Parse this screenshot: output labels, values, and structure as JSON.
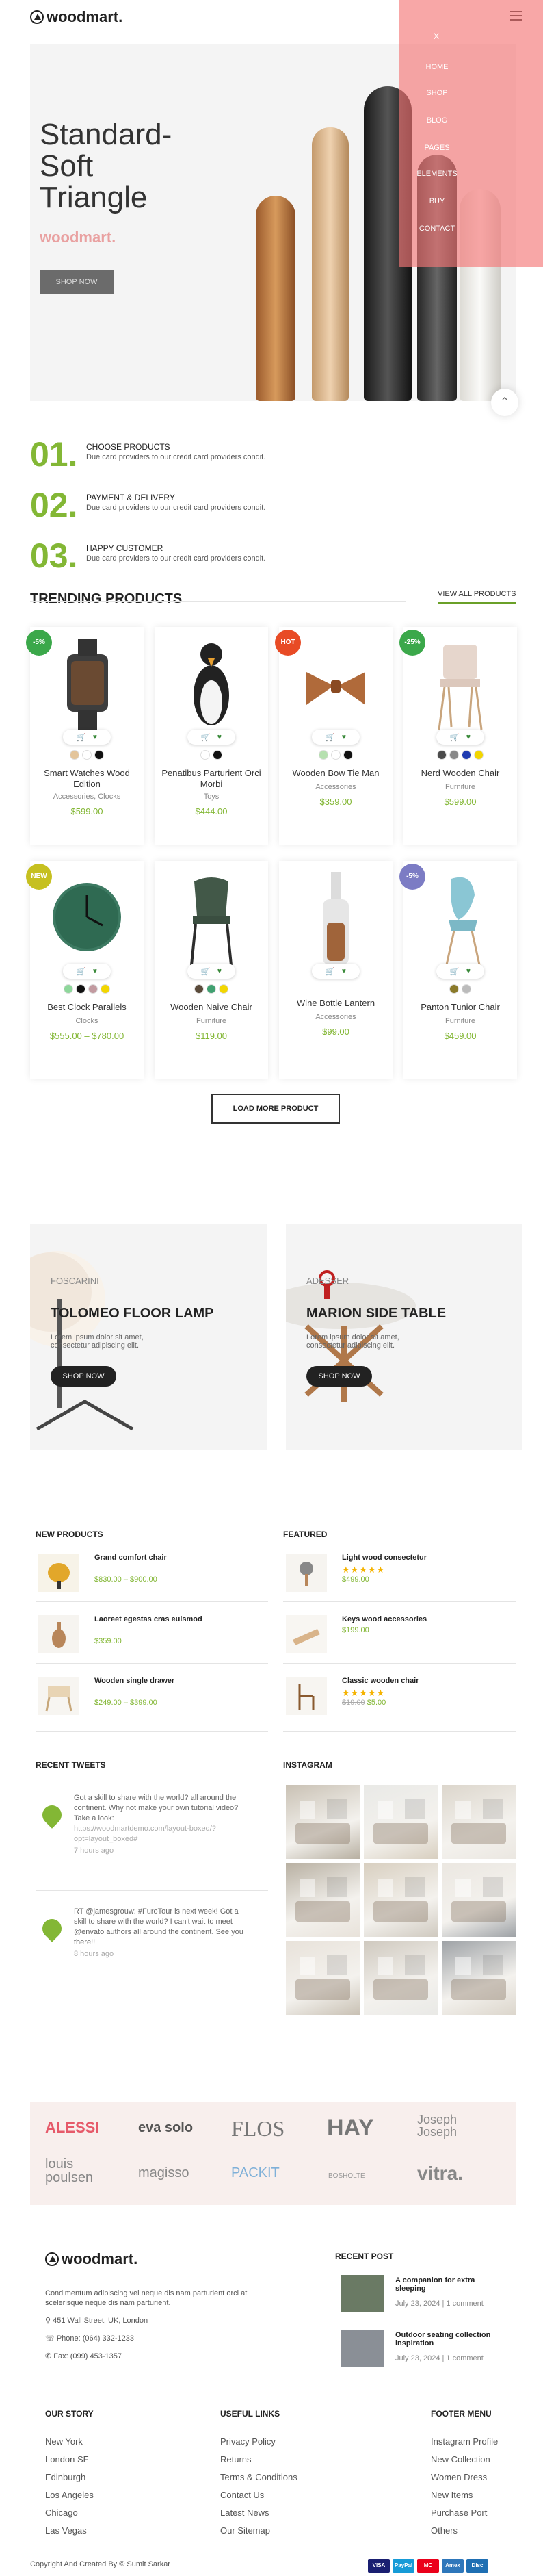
{
  "header": {
    "logo": "woodmart."
  },
  "menu": {
    "close": "X",
    "items": [
      "HOME",
      "SHOP",
      "BLOG",
      "PAGES",
      "ELEMENTS",
      "BUY",
      "CONTACT"
    ]
  },
  "hero": {
    "title": "Standard-Soft Triangle",
    "brand": "woodmart.",
    "button": "SHOP NOW"
  },
  "features": [
    {
      "num": "01.",
      "title": "CHOOSE PRODUCTS",
      "desc": "Due card providers to our credit card providers condit."
    },
    {
      "num": "02.",
      "title": "PAYMENT & DELIVERY",
      "desc": "Due card providers to our credit card providers condit."
    },
    {
      "num": "03.",
      "title": "HAPPY CUSTOMER",
      "desc": "Due card providers to our credit card providers condit."
    }
  ],
  "trending": {
    "title": "TRENDING PRODUCTS",
    "view_all": "VIEW ALL PRODUCTS",
    "products": [
      {
        "badge": "-5%",
        "badge_color": "#3ba84a",
        "name": "Smart Watches Wood Edition",
        "category": "Accessories, Clocks",
        "price": "$599.00",
        "swatches": [
          "#e3c49a",
          "#ffffff",
          "#111111"
        ]
      },
      {
        "badge": "",
        "name": "Penatibus Parturient Orci Morbi",
        "category": "Toys",
        "price": "$444.00",
        "swatches": [
          "#ffffff",
          "#111111"
        ]
      },
      {
        "badge": "HOT",
        "badge_color": "#e84b25",
        "name": "Wooden Bow Tie Man",
        "category": "Accessories",
        "price": "$359.00",
        "swatches": [
          "#b6e0b0",
          "#ffffff",
          "#111111"
        ]
      },
      {
        "badge": "-25%",
        "badge_color": "#3ba84a",
        "name": "Nerd Wooden Chair",
        "category": "Furniture",
        "price": "$599.00",
        "swatches": [
          "#4b4b4b",
          "#888888",
          "#1f3bb0",
          "#f2d600"
        ]
      },
      {
        "badge": "NEW",
        "badge_color": "#c6c020",
        "name": "Best Clock Parallels",
        "category": "Clocks",
        "price": "$555.00 – $780.00",
        "swatches": [
          "#8ed79b",
          "#111111",
          "#c29aa0",
          "#f2d600"
        ]
      },
      {
        "badge": "",
        "name": "Wooden Naive Chair",
        "category": "Furniture",
        "price": "$119.00",
        "swatches": [
          "#5a4a3a",
          "#40a070",
          "#f2d600"
        ]
      },
      {
        "badge": "",
        "name": "Wine Bottle Lantern",
        "category": "Accessories",
        "price": "$99.00",
        "swatches": []
      },
      {
        "badge": "-5%",
        "badge_color": "#7c7cc4",
        "name": "Panton Tunior Chair",
        "category": "Furniture",
        "price": "$459.00",
        "swatches": [
          "#8a7a2a",
          "#bbbbbb"
        ]
      }
    ],
    "load_more": "LOAD MORE PRODUCT"
  },
  "banners": [
    {
      "sub": "FOSCARINI",
      "title": "TOLOMEO FLOOR LAMP",
      "desc": "Lorem ipsum dolor sit amet, consectetur adipiscing elit.",
      "button": "SHOP NOW"
    },
    {
      "sub": "ADESSER",
      "title": "MARION SIDE TABLE",
      "desc": "Lorem ipsum dolor sit amet, consectetur adipiscing elit.",
      "button": "SHOP NOW"
    }
  ],
  "new_products": {
    "title": "NEW PRODUCTS",
    "items": [
      {
        "name": "Grand comfort chair",
        "price": "$830.00 – $900.00"
      },
      {
        "name": "Laoreet egestas cras euismod",
        "price": "$359.00"
      },
      {
        "name": "Wooden single drawer",
        "price": "$249.00 – $399.00"
      }
    ]
  },
  "featured": {
    "title": "FEATURED",
    "items": [
      {
        "name": "Light wood consectetur",
        "stars": "★★★★★",
        "price": "$499.00",
        "old_price": ""
      },
      {
        "name": "Keys wood accessories",
        "stars": "",
        "price": "$199.00",
        "old_price": ""
      },
      {
        "name": "Classic wooden chair",
        "stars": "★★★★★",
        "price": "$5.00",
        "old_price": "$19.00"
      }
    ]
  },
  "tweets": {
    "title": "RECENT TWEETS",
    "items": [
      {
        "text": "Got a skill to share with the world? all around the continent. Why not make your own tutorial video? Take a look:",
        "link": "https://woodmartdemo.com/layout-boxed/?opt=layout_boxed#",
        "time": "7 hours ago"
      },
      {
        "text": "RT @jamesgrouw: #FuroTour is next week! Got a skill to share with the world? I can't wait to meet @envato authors all around the continent. See you there!!",
        "link": "",
        "time": "8 hours ago"
      }
    ]
  },
  "instagram": {
    "title": "INSTAGRAM"
  },
  "brands": [
    "ALESSI",
    "eva solo",
    "FLOS",
    "HAY",
    "Joseph Joseph",
    "louis poulsen",
    "magisso",
    "PACKIT",
    "BOSHOLTE",
    "vitra."
  ],
  "footer": {
    "logo": "woodmart.",
    "about": "Condimentum adipiscing vel neque dis nam parturient orci at scelerisque neque dis nam parturient.",
    "address": "451 Wall Street, UK, London",
    "phone": "Phone: (064) 332-1233",
    "fax": "Fax: (099) 453-1357",
    "recent_post": {
      "title": "RECENT POST",
      "items": [
        {
          "title": "A companion for extra sleeping",
          "date": "July 23, 2024",
          "comments": "1 comment"
        },
        {
          "title": "Outdoor seating collection inspiration",
          "date": "July 23, 2024",
          "comments": "1 comment"
        }
      ]
    },
    "our_story": {
      "title": "OUR STORY",
      "links": [
        "New York",
        "London SF",
        "Edinburgh",
        "Los Angeles",
        "Chicago",
        "Las Vegas"
      ]
    },
    "useful_links": {
      "title": "USEFUL LINKS",
      "links": [
        "Privacy Policy",
        "Returns",
        "Terms & Conditions",
        "Contact Us",
        "Latest News",
        "Our Sitemap"
      ]
    },
    "footer_menu": {
      "title": "FOOTER MENU",
      "links": [
        "Instagram Profile",
        "New Collection",
        "Women Dress",
        "New Items",
        "Purchase Port",
        "Others"
      ]
    },
    "copyright": "Copyright And Created By © Sumit Sarkar",
    "payments": [
      "VISA",
      "PayPal",
      "MC",
      "Amex",
      "Disc"
    ]
  }
}
